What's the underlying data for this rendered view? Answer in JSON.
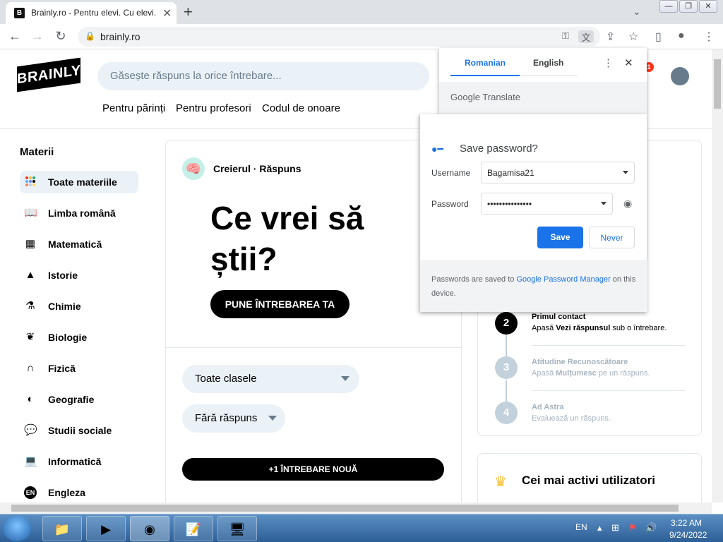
{
  "browser": {
    "tab_title": "Brainly.ro - Pentru elevi. Cu elevi.",
    "tab_favicon": "B",
    "url": "brainly.ro"
  },
  "site": {
    "logo": "BRAINLY",
    "search_placeholder": "Găsește răspuns la orice întrebare...",
    "nav": [
      "Pentru părinți",
      "Pentru profesori",
      "Codul de onoare"
    ],
    "notif_count": "1"
  },
  "sidebar": {
    "title": "Materii",
    "items": [
      {
        "label": "Toate materiile",
        "icon": "dots-grid-icon"
      },
      {
        "label": "Limba română",
        "icon": "book-icon"
      },
      {
        "label": "Matematică",
        "icon": "calculator-icon"
      },
      {
        "label": "Istorie",
        "icon": "triangle-icon"
      },
      {
        "label": "Chimie",
        "icon": "flask-icon"
      },
      {
        "label": "Biologie",
        "icon": "leaf-icon"
      },
      {
        "label": "Fizică",
        "icon": "magnet-icon"
      },
      {
        "label": "Geografie",
        "icon": "globe-icon"
      },
      {
        "label": "Studii sociale",
        "icon": "chat-bubbles-icon"
      },
      {
        "label": "Informatică",
        "icon": "laptop-icon"
      },
      {
        "label": "Engleza",
        "icon": "en-badge-icon"
      }
    ]
  },
  "main": {
    "brain_label": "Creierul · Răspuns",
    "hero_line1": "Ce vrei să",
    "hero_line2": "știi?",
    "ask_button": "PUNE ÎNTREBAREA TA",
    "grade_filter": "Toate clasele",
    "answer_filter": "Fără răspuns",
    "new_question": "+1 ÎNTREBARE NOUĂ"
  },
  "steps": [
    {
      "num": "2",
      "title": "Primul contact",
      "desc_pre": "Apasă ",
      "desc_bold": "Vezi răspunsul",
      "desc_post": " sub o întrebare.",
      "active": true
    },
    {
      "num": "3",
      "title": "Atitudine Recunoscătoare",
      "desc_pre": "Apasă ",
      "desc_bold": "Mulțumesc",
      "desc_post": " pe un răspuns.",
      "active": false
    },
    {
      "num": "4",
      "title": "Ad Astra",
      "desc_pre": "Evaluează un răspuns.",
      "desc_bold": "",
      "desc_post": "",
      "active": false
    }
  ],
  "active_users_title": "Cei mai activi utilizatori",
  "translate_popup": {
    "tab_source": "Romanian",
    "tab_target": "English",
    "brand": "Google Translate"
  },
  "password_popup": {
    "title": "Save password?",
    "username_label": "Username",
    "username_value": "Bagamisa21",
    "password_label": "Password",
    "password_value": "•••••••••••••••",
    "save_label": "Save",
    "never_label": "Never",
    "footer_pre": "Passwords are saved to ",
    "footer_link": "Google Password Manager",
    "footer_post": " on this device."
  },
  "taskbar": {
    "lang": "EN",
    "time": "3:22 AM",
    "date": "9/24/2022"
  },
  "colors": {
    "brand_black": "#000000",
    "google_blue": "#1a73e8",
    "light_panel": "#ebf2f7"
  }
}
